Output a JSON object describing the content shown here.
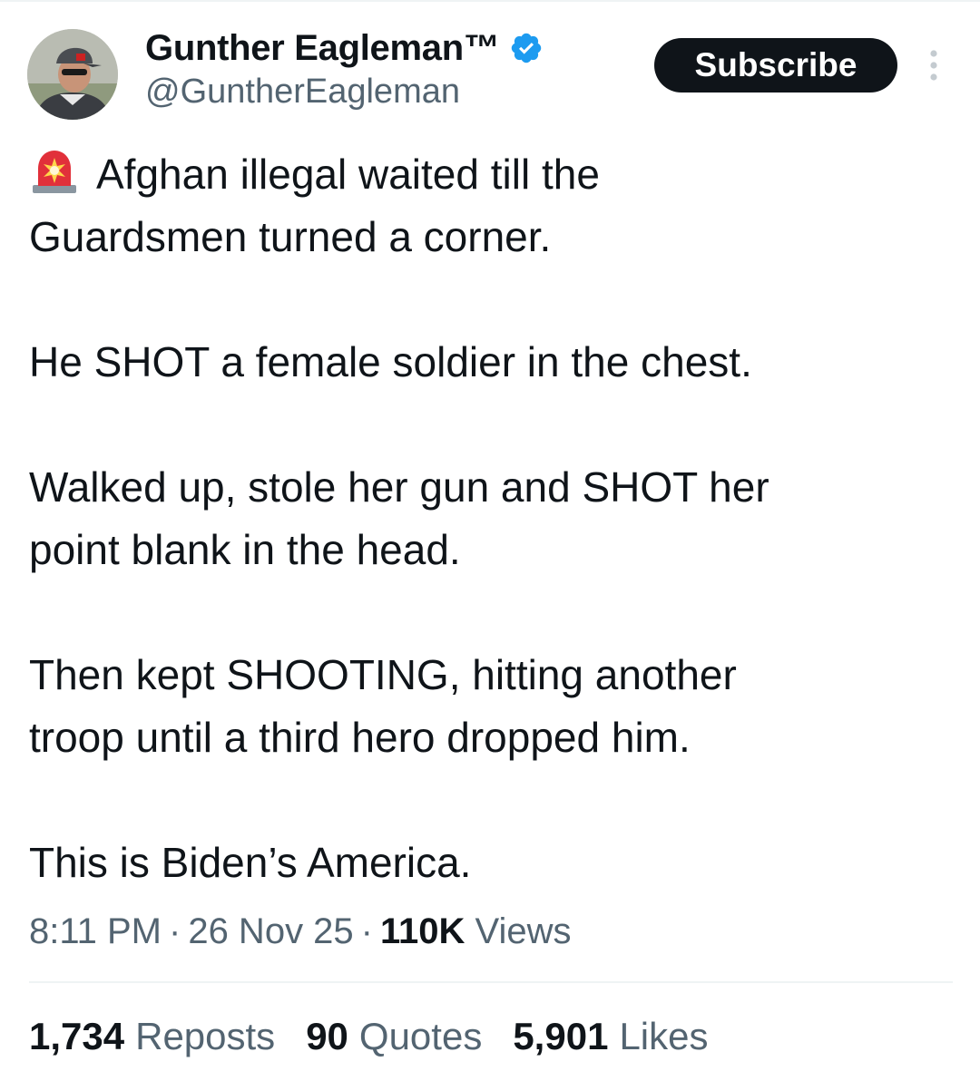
{
  "author": {
    "display_name": "Gunther Eagleman™",
    "handle": "@GuntherEagleman",
    "verified": true
  },
  "actions": {
    "subscribe_label": "Subscribe"
  },
  "tweet": {
    "paragraphs": [
      [
        "Afghan illegal waited till the",
        "Guardsmen turned a corner."
      ],
      [
        "He SHOT a female soldier in the chest."
      ],
      [
        "Walked up, stole her gun and SHOT her",
        "point blank in the head."
      ],
      [
        "Then kept SHOOTING, hitting another",
        "troop until a third hero dropped him."
      ],
      [
        "This is Biden’s America."
      ]
    ],
    "lead_icon": "rotating-light-siren-icon"
  },
  "meta": {
    "time": "8:11 PM",
    "separator": "·",
    "date": "26 Nov 25",
    "views_count": "110K",
    "views_label": "Views"
  },
  "stats": {
    "reposts_count": "1,734",
    "reposts_label": "Reposts",
    "quotes_count": "90",
    "quotes_label": "Quotes",
    "likes_count": "5,901",
    "likes_label": "Likes"
  },
  "colors": {
    "text_primary": "#0f1419",
    "text_secondary": "#536471",
    "verified_blue": "#1d9bf0",
    "button_bg": "#0f1419",
    "divider": "#eff3f4"
  }
}
